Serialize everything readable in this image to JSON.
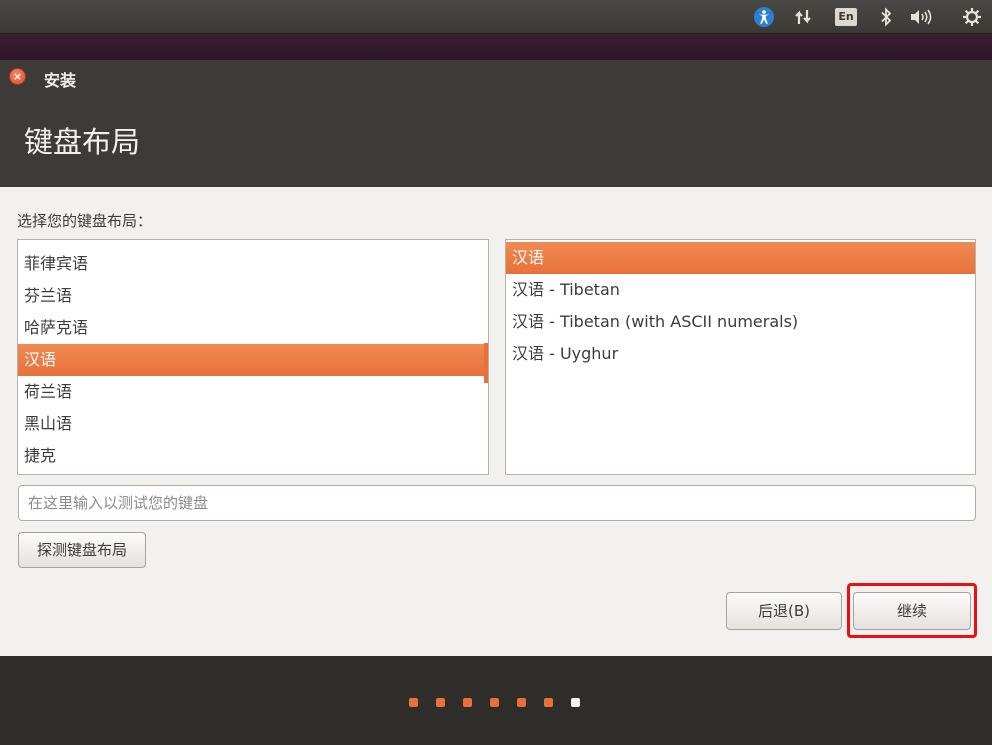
{
  "top_panel": {
    "icons": [
      "accessibility-icon",
      "network-icon",
      "keyboard-indicator-icon",
      "bluetooth-icon",
      "volume-icon",
      "power-settings-icon"
    ],
    "keyboard_indicator": "En"
  },
  "window": {
    "title": "安装",
    "close_glyph": "×"
  },
  "page": {
    "title": "键盘布局",
    "prompt": "选择您的键盘布局："
  },
  "layouts": {
    "items": [
      "菲律宾语",
      "芬兰语",
      "哈萨克语",
      "汉语",
      "荷兰语",
      "黑山语",
      "捷克"
    ],
    "selected": "汉语"
  },
  "variants": {
    "items": [
      "汉语",
      "汉语 - Tibetan",
      "汉语 - Tibetan (with ASCII numerals)",
      "汉语 - Uyghur"
    ],
    "selected": "汉语"
  },
  "test_input": {
    "placeholder": "在这里输入以测试您的键盘",
    "value": ""
  },
  "buttons": {
    "detect": "探测键盘布局",
    "back": "后退(B)",
    "continue": "继续"
  },
  "progress": {
    "total_steps": 7,
    "current_step": 7
  },
  "colors": {
    "accent": "#e8713a",
    "highlight_box": "#ec0f12",
    "header_bg": "#3c3b37"
  }
}
